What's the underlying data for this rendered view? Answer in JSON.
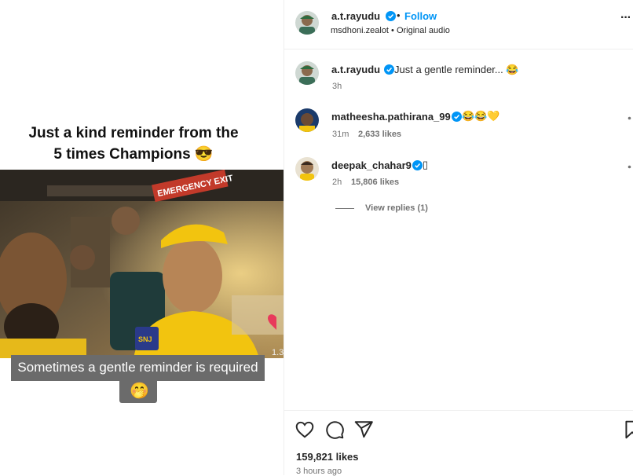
{
  "media": {
    "title_line1": "Just a kind reminder from the",
    "title_line2": "5 times Champions 😎",
    "overlay_caption": "Sometimes a gentle reminder is required",
    "overlay_emoji": "🤭",
    "video_sign": "EMERGENCY EXIT",
    "jersey_badge": "SNJ",
    "counter": "1.3"
  },
  "header": {
    "username": "a.t.rayudu",
    "separator": "•",
    "follow_label": "Follow",
    "audio_line": "msdhoni.zealot • Original audio",
    "more_label": "···"
  },
  "caption": {
    "username": "a.t.rayudu",
    "text": "Just a gentle reminder... 😂",
    "time": "3h"
  },
  "comments": [
    {
      "username": "matheesha.pathirana_99",
      "text": "😂😂💛",
      "time": "31m",
      "likes": "2,633 likes"
    },
    {
      "username": "deepak_chahar9",
      "text": "▯",
      "time": "2h",
      "likes": "15,806 likes",
      "view_replies": "View replies (1)"
    }
  ],
  "footer": {
    "likes": "159,821 likes",
    "timestamp": "3 hours ago"
  },
  "colors": {
    "accent": "#0095f6",
    "verified": "#0095f6",
    "muted": "#737373",
    "jersey": "#f2c40f"
  }
}
